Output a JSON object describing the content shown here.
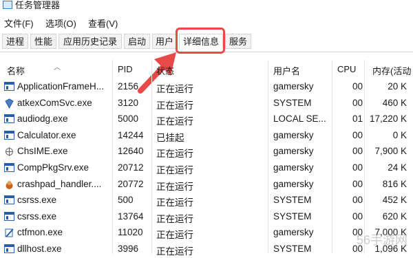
{
  "window": {
    "title": "任务管理器"
  },
  "menu": [
    "文件(F)",
    "选项(O)",
    "查看(V)"
  ],
  "tabs": [
    "进程",
    "性能",
    "应用历史记录",
    "启动",
    "用户",
    "详细信息",
    "服务"
  ],
  "active_tab": "详细信息",
  "columns": {
    "name": "名称",
    "pid": "PID",
    "status": "状态",
    "user": "用户名",
    "cpu": "CPU",
    "memory": "内存(活动"
  },
  "rows": [
    {
      "icon": "window-app-icon",
      "name": "ApplicationFrameH...",
      "pid": "2156",
      "status": "正在运行",
      "user": "gamersky",
      "cpu": "00",
      "memory": "20 K"
    },
    {
      "icon": "shield-app-icon",
      "name": "atkexComSvc.exe",
      "pid": "3120",
      "status": "正在运行",
      "user": "SYSTEM",
      "cpu": "00",
      "memory": "460 K"
    },
    {
      "icon": "window-app-icon",
      "name": "audiodg.exe",
      "pid": "5000",
      "status": "正在运行",
      "user": "LOCAL SE...",
      "cpu": "01",
      "memory": "17,220 K"
    },
    {
      "icon": "window-app-icon",
      "name": "Calculator.exe",
      "pid": "14244",
      "status": "已挂起",
      "user": "gamersky",
      "cpu": "00",
      "memory": "0 K"
    },
    {
      "icon": "ime-app-icon",
      "name": "ChsIME.exe",
      "pid": "12640",
      "status": "正在运行",
      "user": "gamersky",
      "cpu": "00",
      "memory": "7,900 K"
    },
    {
      "icon": "window-app-icon",
      "name": "CompPkgSrv.exe",
      "pid": "20712",
      "status": "正在运行",
      "user": "gamersky",
      "cpu": "00",
      "memory": "24 K"
    },
    {
      "icon": "crashpad-app-icon",
      "name": "crashpad_handler....",
      "pid": "20772",
      "status": "正在运行",
      "user": "gamersky",
      "cpu": "00",
      "memory": "816 K"
    },
    {
      "icon": "window-app-icon",
      "name": "csrss.exe",
      "pid": "500",
      "status": "正在运行",
      "user": "SYSTEM",
      "cpu": "00",
      "memory": "452 K"
    },
    {
      "icon": "window-app-icon",
      "name": "csrss.exe",
      "pid": "13764",
      "status": "正在运行",
      "user": "SYSTEM",
      "cpu": "00",
      "memory": "620 K"
    },
    {
      "icon": "ctfmon-app-icon",
      "name": "ctfmon.exe",
      "pid": "11020",
      "status": "正在运行",
      "user": "gamersky",
      "cpu": "00",
      "memory": "7,000 K"
    },
    {
      "icon": "window-app-icon",
      "name": "dllhost.exe",
      "pid": "3996",
      "status": "正在运行",
      "user": "SYSTEM",
      "cpu": "00",
      "memory": "1,096 K"
    }
  ],
  "annotation": {
    "highlight_color": "#e84a4a"
  },
  "watermark": "56手游网"
}
